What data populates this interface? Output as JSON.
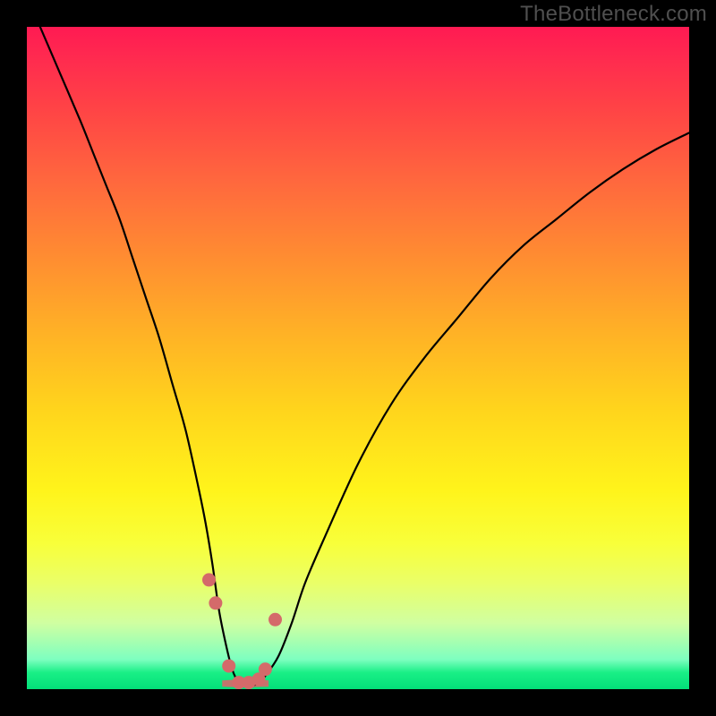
{
  "watermark": "TheBottleneck.com",
  "colors": {
    "frame": "#000000",
    "watermark_text": "#4f4f4f",
    "curve": "#000000",
    "marker": "#d46a6a",
    "gradient_top": "#ff1a52",
    "gradient_mid": "#fff41b",
    "gradient_bottom": "#03df79"
  },
  "chart_data": {
    "type": "line",
    "title": "",
    "xlabel": "",
    "ylabel": "",
    "xlim": [
      0,
      100
    ],
    "ylim": [
      0,
      100
    ],
    "series": [
      {
        "name": "bottleneck-curve",
        "x": [
          2,
          5,
          8,
          10,
          12,
          14,
          16,
          18,
          20,
          22,
          24,
          26,
          27,
          28,
          29,
          30,
          31,
          32,
          33,
          34,
          35,
          36,
          38,
          40,
          42,
          45,
          50,
          55,
          60,
          65,
          70,
          75,
          80,
          85,
          90,
          95,
          100
        ],
        "values": [
          100,
          93,
          86,
          81,
          76,
          71,
          65,
          59,
          53,
          46,
          39,
          30,
          25,
          19,
          12,
          7,
          3,
          1,
          0.5,
          0.5,
          1,
          2,
          5,
          10,
          16,
          23,
          34,
          43,
          50,
          56,
          62,
          67,
          71,
          75,
          78.5,
          81.5,
          84
        ]
      }
    ],
    "markers": {
      "name": "sweet-spot-markers",
      "x": [
        27.5,
        28.5,
        30.5,
        32.0,
        33.5,
        35.0,
        36.0,
        37.5
      ],
      "values": [
        16.5,
        13.0,
        3.5,
        1.0,
        1.0,
        1.5,
        3.0,
        10.5
      ]
    },
    "spread_band": {
      "xmin": 29.5,
      "xmax": 36.5,
      "y": 0.5
    }
  }
}
